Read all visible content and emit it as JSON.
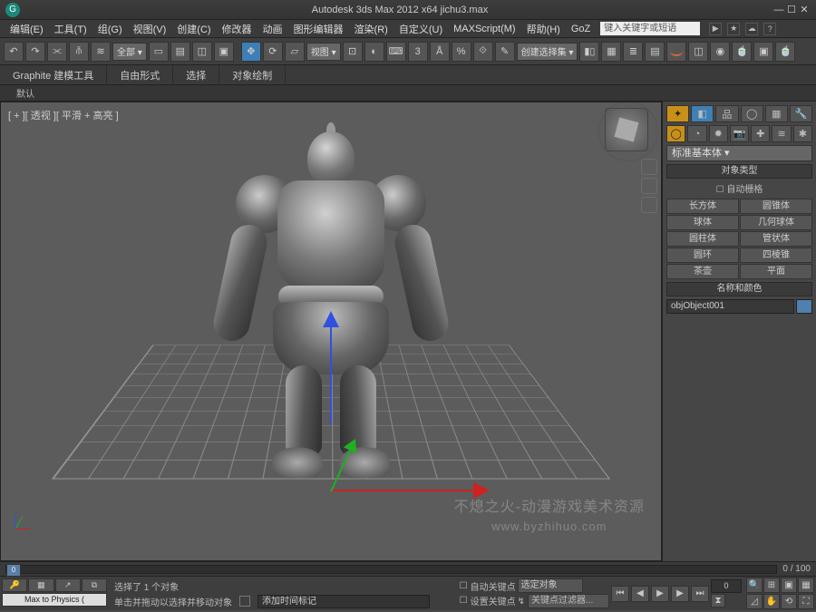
{
  "app": {
    "title": "Autodesk 3ds Max  2012 x64     jichu3.max"
  },
  "menu": {
    "items": [
      "编辑(E)",
      "工具(T)",
      "组(G)",
      "视图(V)",
      "创建(C)",
      "修改器",
      "动画",
      "图形编辑器",
      "渲染(R)",
      "自定义(U)",
      "MAXScript(M)",
      "帮助(H)",
      "GoZ"
    ],
    "search_placeholder": "键入关键字或短语"
  },
  "toolbar": {
    "set_dropdown": "全部 ▾",
    "view_dropdown": "视图 ▾",
    "create_dropdown": "创建选择集 ▾"
  },
  "ribbon": {
    "tabs": [
      "Graphite 建模工具",
      "自由形式",
      "选择",
      "对象绘制"
    ],
    "sub": "默认"
  },
  "viewport": {
    "label": "[ + ][ 透视 ][ 平滑 + 高亮 ]",
    "watermark_line1": "不熄之火-动漫游戏美术资源",
    "watermark_line2": "www.byzhihuo.com"
  },
  "cmd_panel": {
    "category": "标准基本体 ▾",
    "rollout_type": "对象类型",
    "autogrid": "自动栅格",
    "primitives": [
      "长方体",
      "圆锥体",
      "球体",
      "几何球体",
      "圆柱体",
      "管状体",
      "圆环",
      "四棱锥",
      "茶壶",
      "平面"
    ],
    "rollout_name": "名称和颜色",
    "object_name": "objObject001"
  },
  "timeline": {
    "current": "0",
    "range": "0 / 100"
  },
  "status": {
    "script_btn": "Max to Physics (",
    "sel_text": "选择了 1 个对象",
    "hint": "单击并拖动以选择并移动对象",
    "prompt": "添加时间标记",
    "autokey_label": "自动关键点",
    "setkey_label": "设置关键点",
    "sel_filter": "选定对象",
    "key_filter": "关键点过滤器...",
    "frame": "0"
  }
}
